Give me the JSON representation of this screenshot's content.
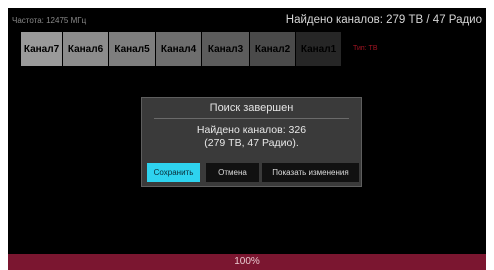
{
  "header": {
    "frequency": "Частота: 12475 МГц",
    "found_summary": "Найдено каналов: 279 ТВ / 47 Радио"
  },
  "channels": [
    {
      "label": "Канал7",
      "color": "#9a9a9a"
    },
    {
      "label": "Канал6",
      "color": "#8c8c8c"
    },
    {
      "label": "Канал5",
      "color": "#7e7e7e"
    },
    {
      "label": "Канал4",
      "color": "#6e6e6e"
    },
    {
      "label": "Канал3",
      "color": "#5c5c5c"
    },
    {
      "label": "Канал2",
      "color": "#4a4a4a"
    },
    {
      "label": "Канал1",
      "color": "#262626"
    }
  ],
  "channel_type_tag": "Тип: ТВ",
  "dialog": {
    "title": "Поиск завершен",
    "message_line1": "Найдено каналов: 326",
    "message_line2": "(279 ТВ, 47 Радио).",
    "save_label": "Сохранить",
    "cancel_label": "Отмена",
    "show_changes_label": "Показать изменения"
  },
  "progress": {
    "value": 100,
    "label": "100%"
  },
  "colors": {
    "accent": "#2ed3ef",
    "progress": "#7b1630",
    "dialog_bg": "#3a3a3a"
  }
}
